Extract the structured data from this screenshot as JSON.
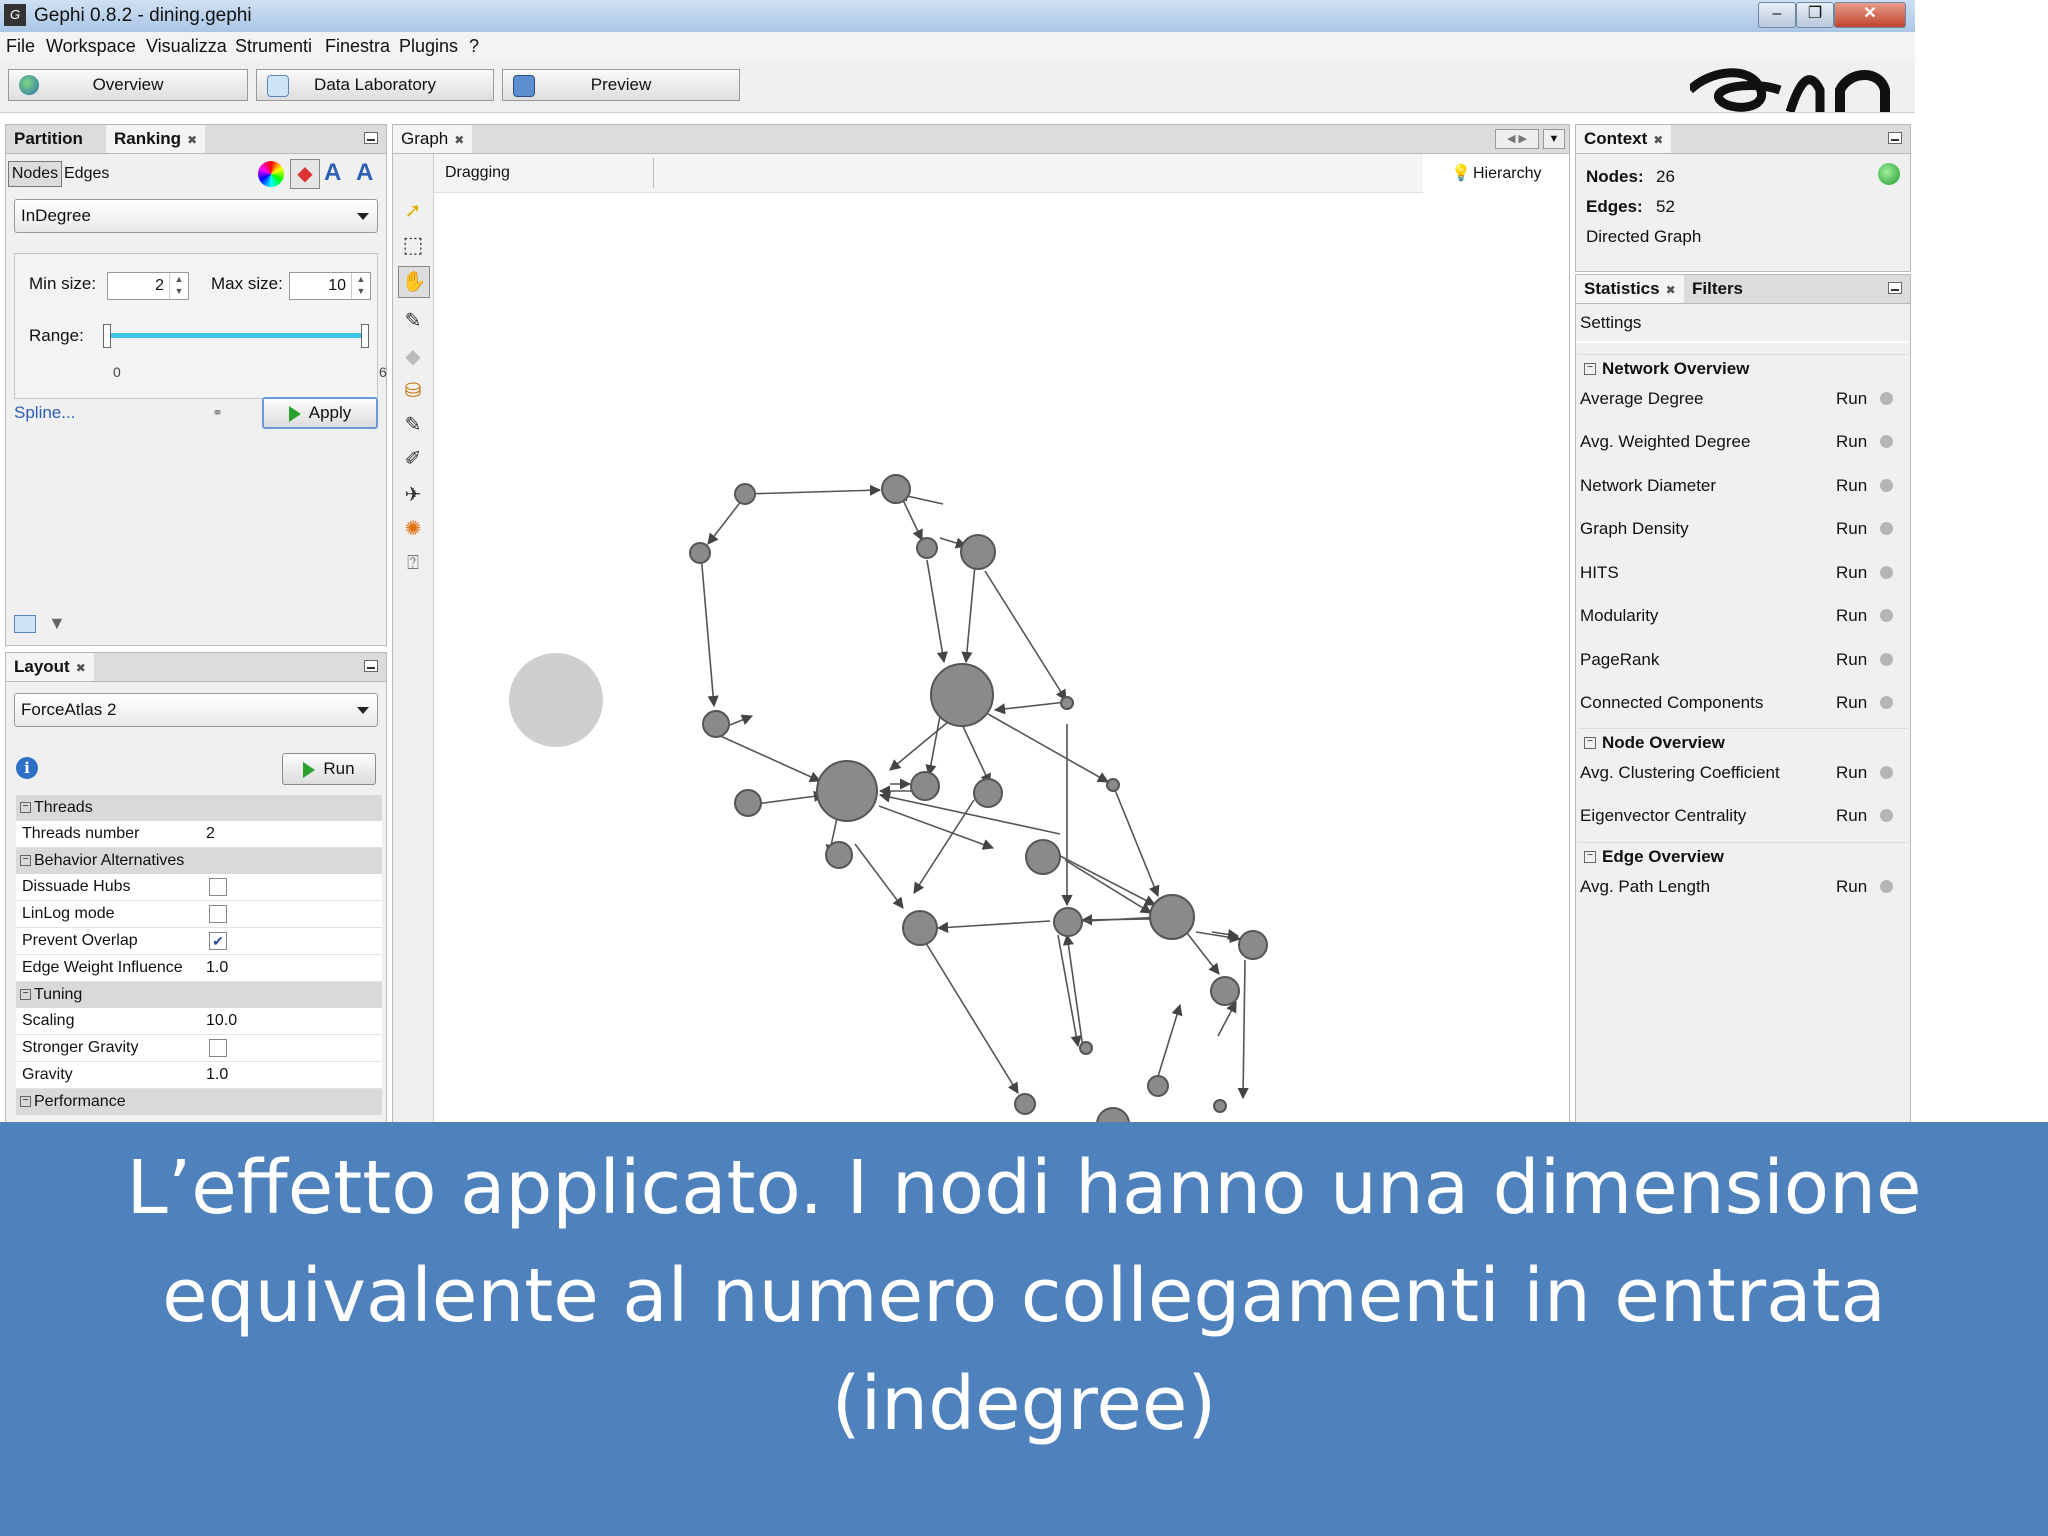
{
  "window": {
    "title": "Gephi 0.8.2 - dining.gephi",
    "app_icon": "gephi-logo-icon",
    "controls": [
      "minimize",
      "maximize",
      "close"
    ]
  },
  "menubar": [
    "File",
    "Workspace",
    "Visualizza",
    "Strumenti",
    "Finestra",
    "Plugins",
    "?"
  ],
  "perspectives": [
    "Overview",
    "Data Laboratory",
    "Preview"
  ],
  "ranking_panel": {
    "tabs": [
      "Partition",
      "Ranking"
    ],
    "subtabs": [
      "Nodes",
      "Edges"
    ],
    "attribute": "InDegree",
    "min_size_label": "Min size:",
    "min_size": "2",
    "max_size_label": "Max size:",
    "max_size": "10",
    "range_label": "Range:",
    "range_min": "0",
    "range_max": "6",
    "spline_link": "Spline...",
    "apply_label": "Apply"
  },
  "layout_panel": {
    "tab": "Layout",
    "algorithm": "ForceAtlas 2",
    "run_label": "Run",
    "groups": [
      {
        "name": "Threads",
        "rows": [
          {
            "key": "Threads number",
            "value": "2"
          }
        ]
      },
      {
        "name": "Behavior Alternatives",
        "rows": [
          {
            "key": "Dissuade Hubs",
            "checked": false
          },
          {
            "key": "LinLog mode",
            "checked": false
          },
          {
            "key": "Prevent Overlap",
            "checked": true
          },
          {
            "key": "Edge Weight Influence",
            "value": "1.0"
          }
        ]
      },
      {
        "name": "Tuning",
        "rows": [
          {
            "key": "Scaling",
            "value": "10.0"
          },
          {
            "key": "Stronger Gravity",
            "checked": false
          },
          {
            "key": "Gravity",
            "value": "1.0"
          }
        ]
      },
      {
        "name": "Performance",
        "rows": []
      }
    ]
  },
  "graph_panel": {
    "tab": "Graph",
    "mode": "Dragging",
    "hierarchy_label": "Hierarchy"
  },
  "context_panel": {
    "tab": "Context",
    "nodes_label": "Nodes:",
    "nodes": "26",
    "edges_label": "Edges:",
    "edges": "52",
    "graph_type": "Directed Graph"
  },
  "statistics_panel": {
    "tabs": [
      "Statistics",
      "Filters"
    ],
    "settings_label": "Settings",
    "run_label": "Run",
    "sections": [
      {
        "name": "Network Overview",
        "items": [
          "Average Degree",
          "Avg. Weighted Degree",
          "Network Diameter",
          "Graph Density",
          "HITS",
          "Modularity",
          "PageRank",
          "Connected Components"
        ]
      },
      {
        "name": "Node Overview",
        "items": [
          "Avg. Clustering Coefficient",
          "Eigenvector Centrality"
        ]
      },
      {
        "name": "Edge Overview",
        "items": [
          "Avg. Path Length"
        ]
      }
    ]
  },
  "caption": {
    "line1": "L’effetto applicato. I nodi hanno una dimensione",
    "line2": "equivalente al numero collegamenti in entrata",
    "line3": "(indegree)"
  },
  "colors": {
    "caption_bg": "#4f81bd",
    "node_fill": "#8c8c8c",
    "edge": "#555555",
    "panel_bg": "#f0f0f0"
  }
}
